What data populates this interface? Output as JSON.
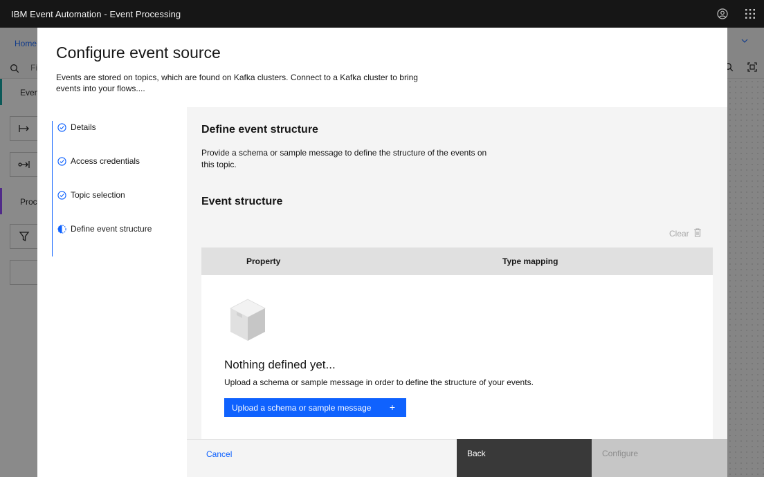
{
  "app": {
    "title": "IBM Event Automation - Event Processing"
  },
  "background": {
    "breadcrumb": "Home",
    "search_placeholder": "Fi",
    "section_events": "Event",
    "section_processors": "Proce"
  },
  "modal": {
    "title": "Configure event source",
    "description": "Events are stored on topics, which are found on Kafka clusters. Connect to a Kafka cluster to bring events into your flows....",
    "steps": [
      {
        "label": "Details",
        "status": "complete"
      },
      {
        "label": "Access credentials",
        "status": "complete"
      },
      {
        "label": "Topic selection",
        "status": "complete"
      },
      {
        "label": "Define event structure",
        "status": "current"
      }
    ],
    "content": {
      "heading": "Define event structure",
      "description": "Provide a schema or sample message to define the structure of the events on this topic.",
      "subheading": "Event structure",
      "clear_label": "Clear",
      "table": {
        "columns": [
          "Property",
          "Type mapping"
        ]
      },
      "empty_state": {
        "icon": "box-icon",
        "title": "Nothing defined yet...",
        "description": "Upload a schema or sample message in order to define the structure of your events.",
        "button_label": "Upload a schema or sample message",
        "button_icon": "+"
      }
    },
    "footer": {
      "cancel_label": "Cancel",
      "back_label": "Back",
      "configure_label": "Configure"
    }
  },
  "colors": {
    "primary": "#0f62fe",
    "topbar": "#161616",
    "back_button": "#393939",
    "disabled_button": "#c6c6c6"
  }
}
